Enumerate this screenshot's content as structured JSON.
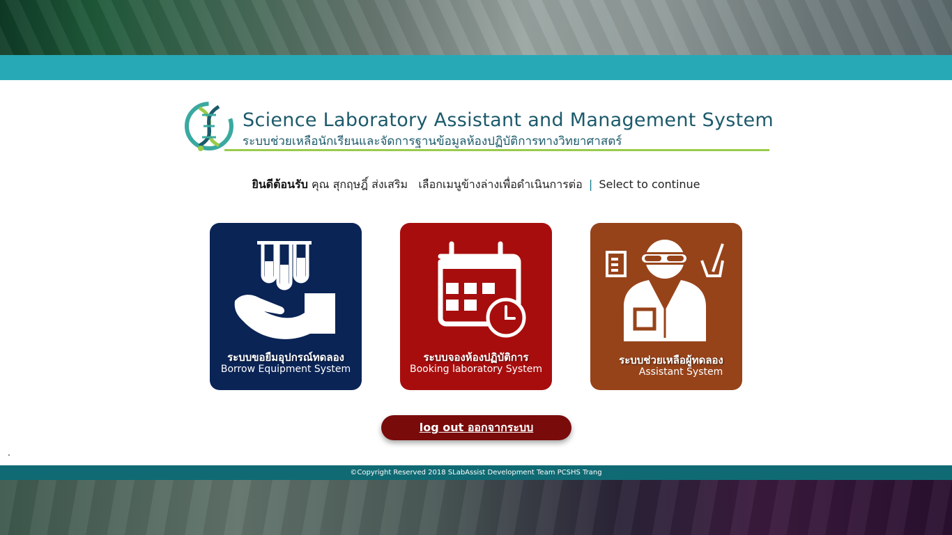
{
  "header": {
    "title_en": "Science Laboratory Assistant and Management System",
    "title_th": "ระบบช่วยเหลือนักเรียนและจัดการฐานข้อมูลห้องปฏิบัติการทางวิทยาศาสตร์"
  },
  "welcome": {
    "greeting": "ยินดีต้อนรับ",
    "user": "คุณ สุกฤษฎิ์ ส่งเสริม",
    "instruction_th": "เลือกเมนูข้างล่างเพื่อดำเนินการต่อ",
    "separator": "|",
    "instruction_en": "Select to continue"
  },
  "menu": [
    {
      "title_th": "ระบบขอยืมอุปกรณ์ทดลอง",
      "title_en": "Borrow Equipment System",
      "color": "#0a2456",
      "icon": "hand-test-tubes-icon"
    },
    {
      "title_th": "ระบบจองห้องปฏิบัติการ",
      "title_en": "Booking laboratory System",
      "color": "#a80d0d",
      "icon": "calendar-clock-icon"
    },
    {
      "title_th": "ระบบช่วยเหลือผู้ทดลอง",
      "title_en": "Assistant System",
      "color": "#97431a",
      "icon": "lab-assistant-icon"
    }
  ],
  "logout_label": "log out ออกจากระบบ",
  "stray_mark": ".",
  "footer": "©Copyright Reserved 2018 SLabAssist Development Team PCSHS Trang",
  "colors": {
    "teal_band": "#28a9b6",
    "footer_bg": "#0f6a73",
    "logout_bg": "#7a0b0b"
  }
}
